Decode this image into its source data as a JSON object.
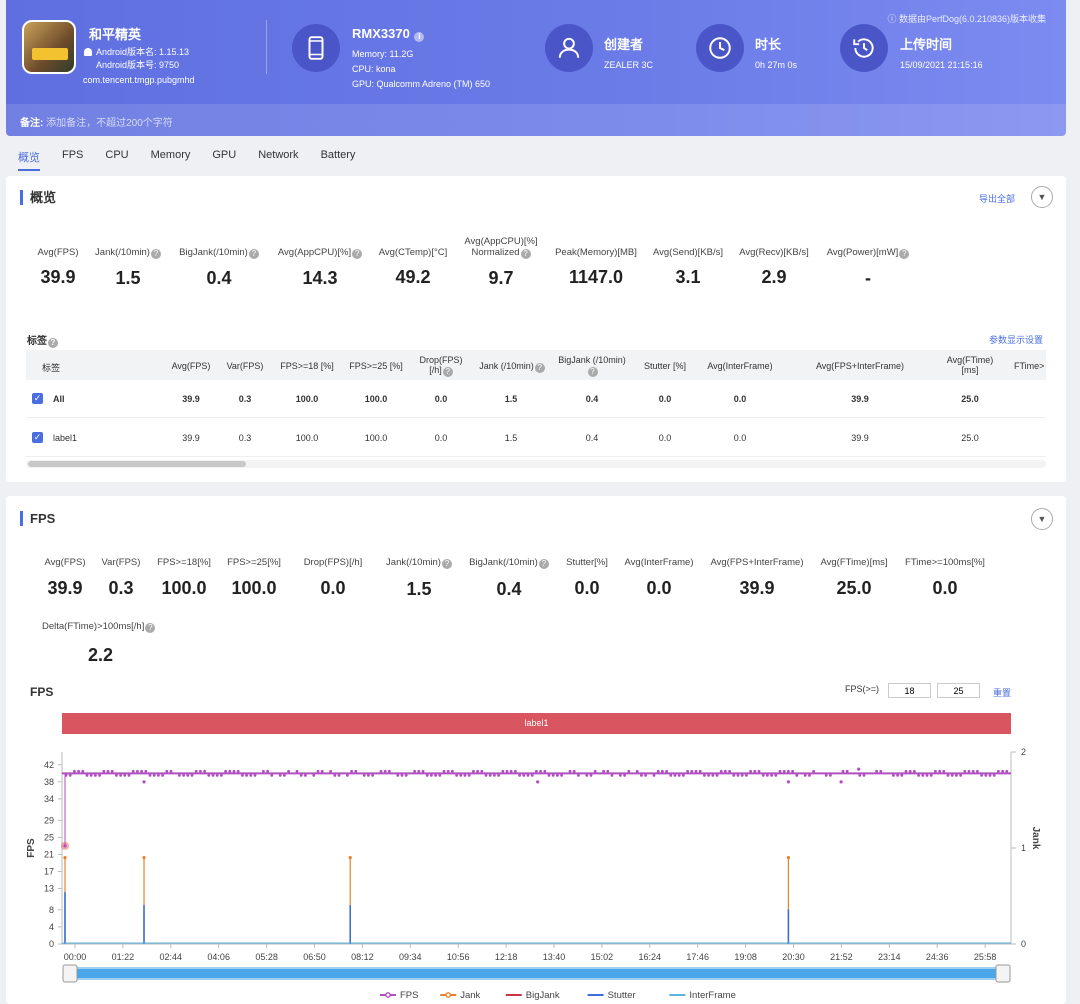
{
  "header": {
    "app_name": "和平精英",
    "android_version_name": "Android版本名: 1.15.13",
    "android_version_code": "Android版本号: 9750",
    "package": "com.tencent.tmgp.pubgmhd",
    "device": {
      "model": "RMX3370",
      "memory": "Memory: 11.2G",
      "cpu": "CPU: kona",
      "gpu": "GPU: Qualcomm Adreno (TM) 650"
    },
    "creator": {
      "title": "创建者",
      "value": "ZEALER 3C"
    },
    "duration": {
      "title": "时长",
      "value": "0h 27m 0s"
    },
    "upload": {
      "title": "上传时间",
      "value": "15/09/2021 21:15:16"
    },
    "collect_info": "ⓘ 数据由PerfDog(6.0.210836)版本收集",
    "note_label": "备注:",
    "note_placeholder": "添加备注，不超过200个字符",
    "icons": [
      "phone-icon",
      "user-icon",
      "clock-icon",
      "history-icon"
    ]
  },
  "tabs": [
    "概览",
    "FPS",
    "CPU",
    "Memory",
    "GPU",
    "Network",
    "Battery"
  ],
  "overview": {
    "title": "概览",
    "export_all": "导出全部",
    "metrics": [
      {
        "label": "Avg(FPS)",
        "value": "39.9"
      },
      {
        "label": "Jank(/10min)",
        "value": "1.5"
      },
      {
        "label": "BigJank(/10min)",
        "value": "0.4"
      },
      {
        "label": "Avg(AppCPU)[%]",
        "value": "14.3"
      },
      {
        "label": "Avg(CTemp)[°C]",
        "value": "49.2"
      },
      {
        "label": "Avg(AppCPU)[%]",
        "label2": "Normalized",
        "value": "9.7"
      },
      {
        "label": "Peak(Memory)[MB]",
        "value": "1147.0"
      },
      {
        "label": "Avg(Send)[KB/s]",
        "value": "3.1"
      },
      {
        "label": "Avg(Recv)[KB/s]",
        "value": "2.9"
      },
      {
        "label": "Avg(Power)[mW]",
        "value": "-"
      }
    ],
    "tags_title": "标签",
    "param_settings": "参数显示设置",
    "table": {
      "headers": [
        "标签",
        "Avg(FPS)",
        "Var(FPS)",
        "FPS>=18 [%]",
        "FPS>=25 [%]",
        "Drop(FPS)",
        "Jank (/10min)",
        "BigJank (/10min)",
        "Stutter [%]",
        "Avg(InterFrame)",
        "Avg(FPS+InterFrame)",
        "Avg(FTime)",
        "FTime>"
      ],
      "header_line2": {
        "drop": "[/h]",
        "ftime": "[ms]"
      },
      "rows": [
        [
          "All",
          "39.9",
          "0.3",
          "100.0",
          "100.0",
          "0.0",
          "1.5",
          "0.4",
          "0.0",
          "0.0",
          "39.9",
          "25.0"
        ],
        [
          "label1",
          "39.9",
          "0.3",
          "100.0",
          "100.0",
          "0.0",
          "1.5",
          "0.4",
          "0.0",
          "0.0",
          "39.9",
          "25.0"
        ]
      ]
    }
  },
  "fps_section": {
    "title": "FPS",
    "metrics": [
      {
        "label": "Avg(FPS)",
        "value": "39.9"
      },
      {
        "label": "Var(FPS)",
        "value": "0.3"
      },
      {
        "label": "FPS>=18[%]",
        "value": "100.0"
      },
      {
        "label": "FPS>=25[%]",
        "value": "100.0"
      },
      {
        "label": "Drop(FPS)[/h]",
        "value": "0.0"
      },
      {
        "label": "Jank(/10min)",
        "value": "1.5"
      },
      {
        "label": "BigJank(/10min)",
        "value": "0.4"
      },
      {
        "label": "Stutter[%]",
        "value": "0.0"
      },
      {
        "label": "Avg(InterFrame)",
        "value": "0.0"
      },
      {
        "label": "Avg(FPS+InterFrame)",
        "value": "39.9"
      },
      {
        "label": "Avg(FTime)[ms]",
        "value": "25.0"
      },
      {
        "label": "FTime>=100ms[%]",
        "value": "0.0"
      }
    ],
    "delta_label": "Delta(FTime)>100ms[/h]",
    "delta_value": "2.2",
    "chart_title": "FPS",
    "threshold_label": "FPS(>=)",
    "threshold_1": "18",
    "threshold_2": "25",
    "reset": "重置",
    "label_bar": "label1"
  },
  "chart_data": {
    "type": "line",
    "x": [
      "00:00",
      "01:22",
      "02:44",
      "04:06",
      "05:28",
      "06:50",
      "08:12",
      "09:34",
      "10:56",
      "12:18",
      "13:40",
      "15:02",
      "16:24",
      "17:46",
      "19:08",
      "20:30",
      "21:52",
      "23:14",
      "24:36",
      "25:58"
    ],
    "y_ticks": [
      0,
      4,
      8,
      13,
      17,
      21,
      25,
      29,
      34,
      38,
      42
    ],
    "ylabel": "FPS",
    "y2label": "Jank",
    "y2_ticks": [
      0,
      1,
      2
    ],
    "ylim": [
      0,
      45
    ],
    "y2lim": [
      0,
      2
    ],
    "xlim": [
      0,
      1620
    ],
    "series": [
      {
        "name": "FPS",
        "color": "#b04fc0",
        "baseline": 40,
        "dips": [
          {
            "t": 0,
            "v": 23
          },
          {
            "t": 140,
            "v": 38
          },
          {
            "t": 812,
            "v": 38
          },
          {
            "t": 1240,
            "v": 38
          },
          {
            "t": 1330,
            "v": 38
          },
          {
            "t": 1360,
            "v": 41
          }
        ]
      },
      {
        "name": "Jank",
        "color": "#e8822a",
        "events": [
          {
            "t": 0,
            "v": 1
          },
          {
            "t": 140,
            "v": 1
          },
          {
            "t": 492,
            "v": 1
          },
          {
            "t": 1240,
            "v": 1
          }
        ]
      },
      {
        "name": "BigJank",
        "color": "#c8334a",
        "events": []
      },
      {
        "name": "Stutter",
        "color": "#3d6fd6",
        "events": [
          {
            "t": 0,
            "v": 0.6
          },
          {
            "t": 140,
            "v": 0.45
          },
          {
            "t": 492,
            "v": 0.45
          },
          {
            "t": 1240,
            "v": 0.4
          }
        ]
      },
      {
        "name": "InterFrame",
        "color": "#5bb3e0",
        "events": []
      }
    ]
  }
}
